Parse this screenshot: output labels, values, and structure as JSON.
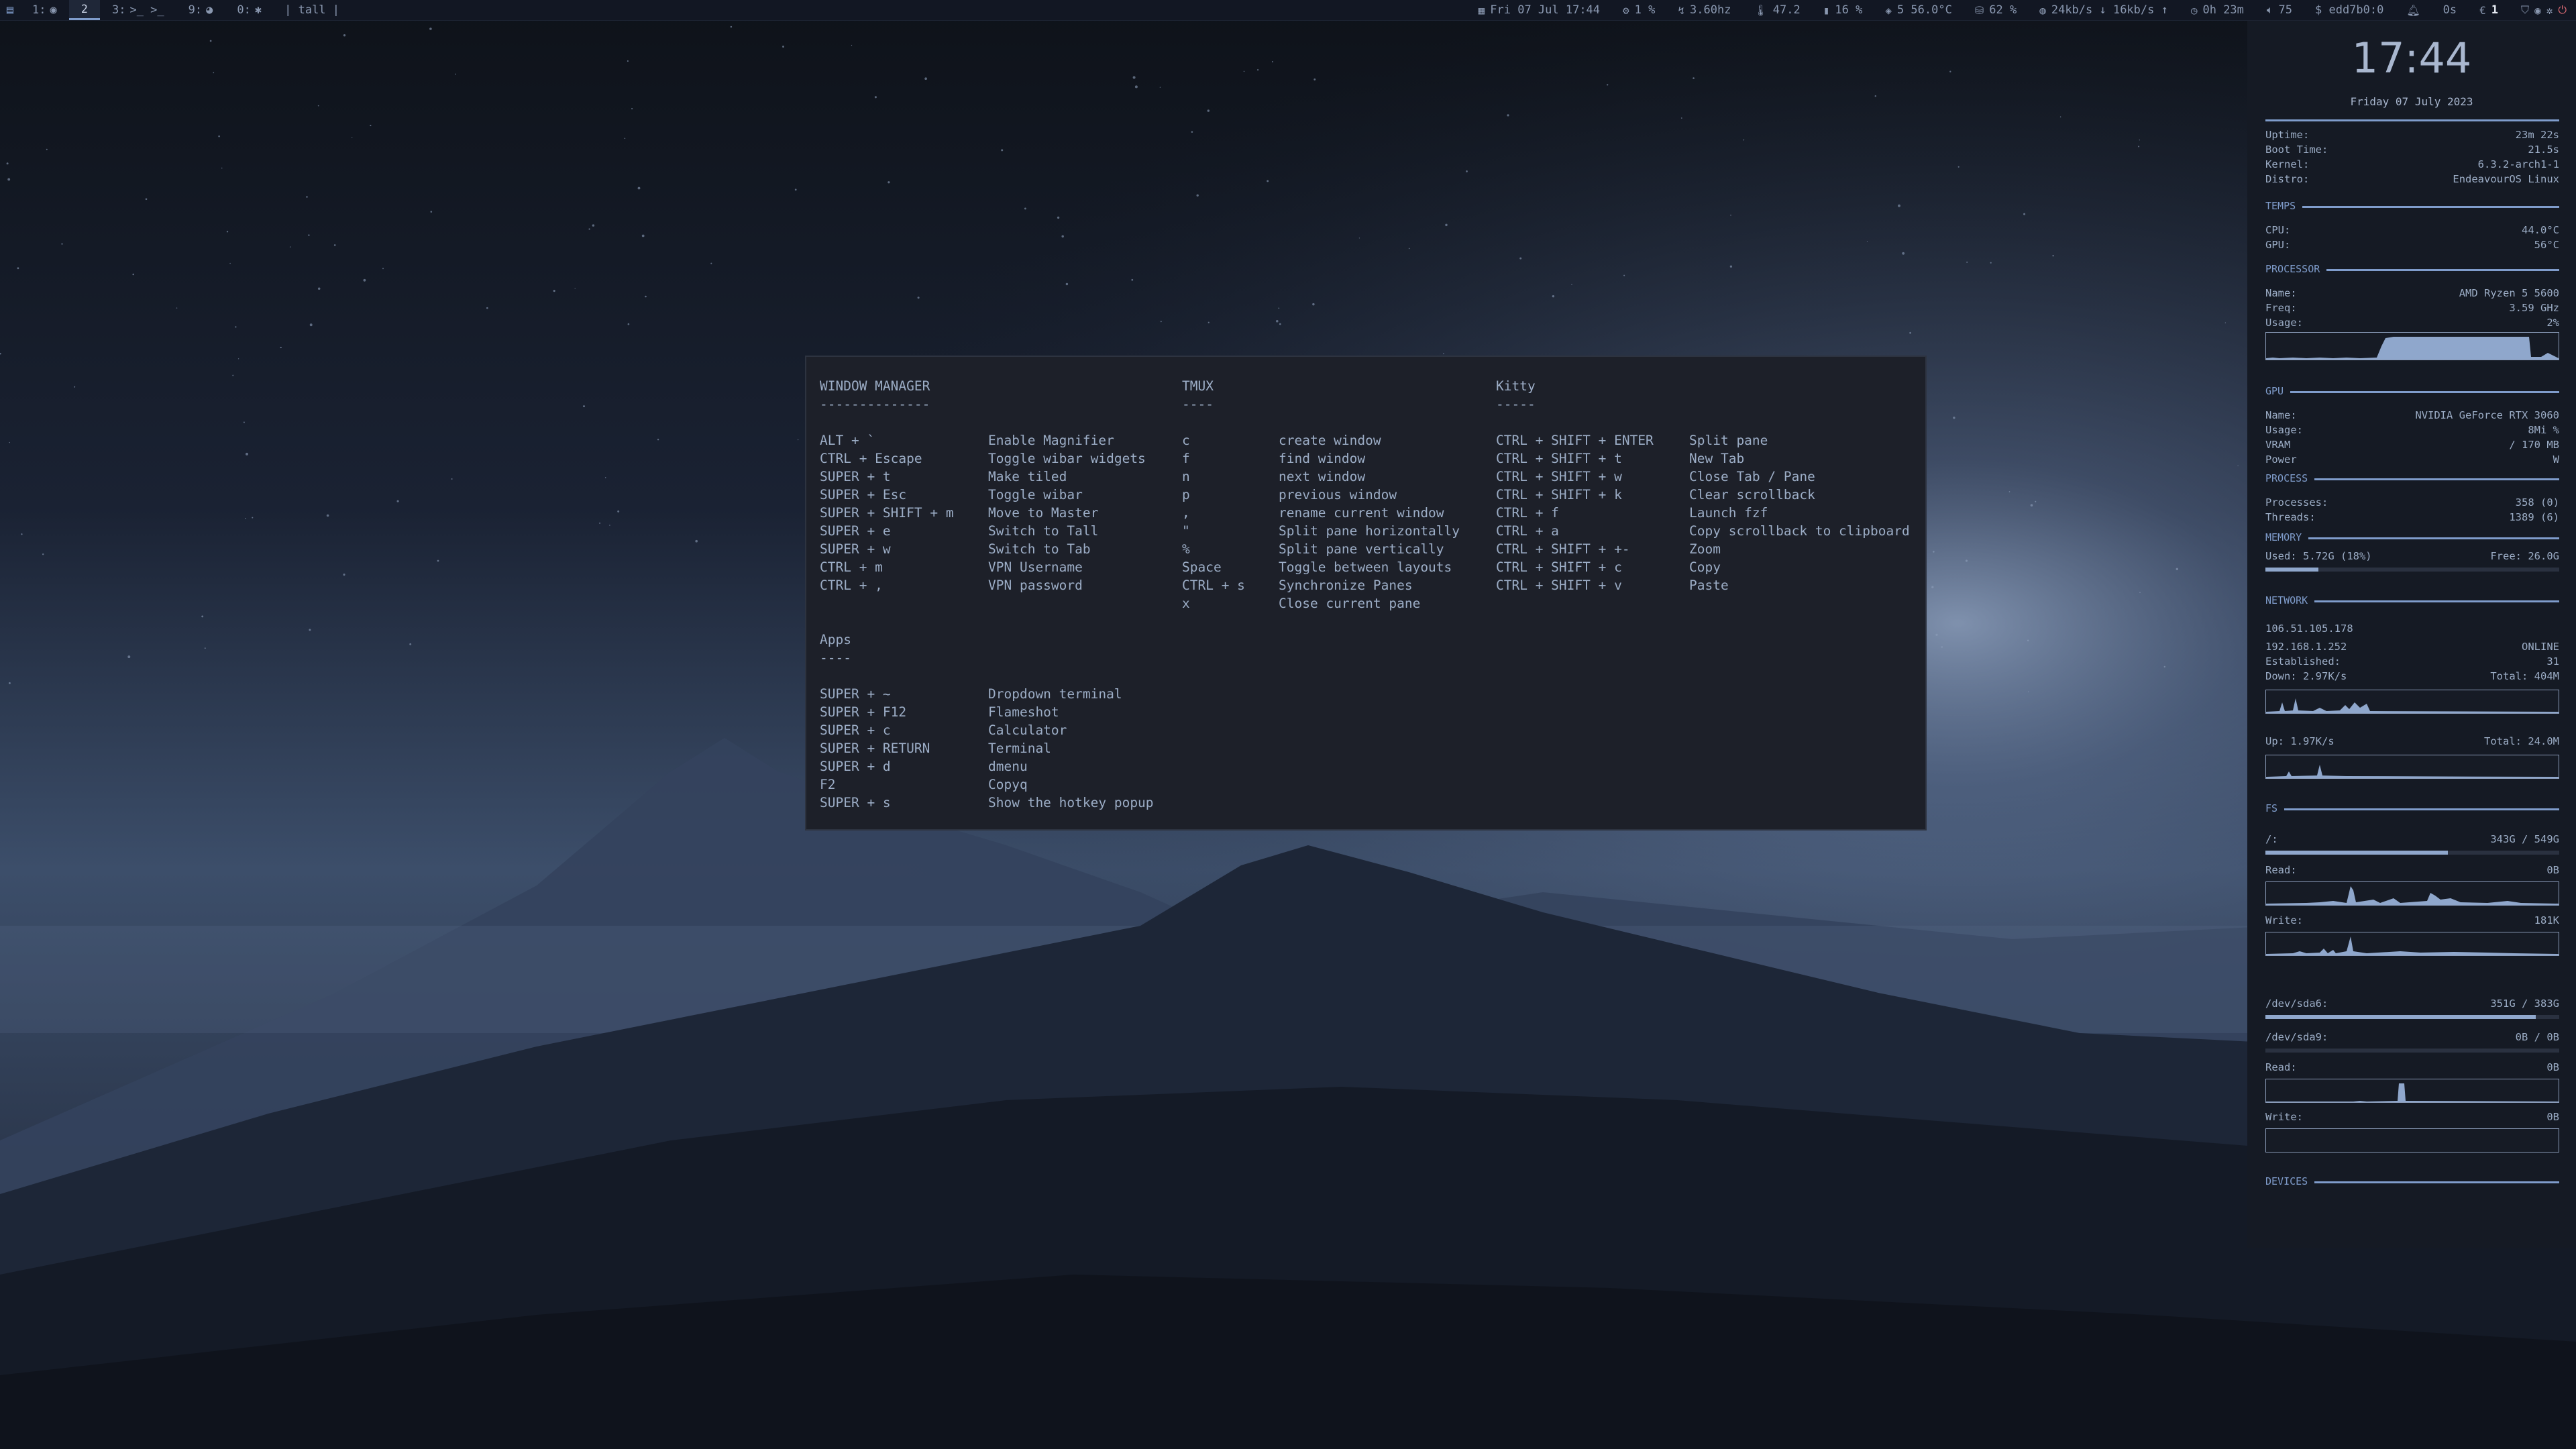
{
  "topbar": {
    "workspaces": [
      {
        "label": "1:",
        "icon": "firefox-icon",
        "glyph": "◉",
        "active": false
      },
      {
        "label": "2",
        "icon": "",
        "glyph": "",
        "active": true
      },
      {
        "label": "3:",
        "icon": "terminal-icon",
        "glyph": ">_ >_",
        "active": false
      },
      {
        "label": "9:",
        "icon": "spotify-icon",
        "glyph": "◕",
        "active": false
      },
      {
        "label": "0:",
        "icon": "gear-icon",
        "glyph": "✱",
        "active": false
      }
    ],
    "layout": "| tall |",
    "date": "Fri 07 Jul 17:44",
    "cpu": "1 %",
    "freq": "3.60hz",
    "temp": "47.2",
    "mem": "16 %",
    "gpu": "5 56.0°C",
    "disk": "62 %",
    "net": "24kb/s ↓ 16kb/s ↑",
    "uptime": "0h 23m",
    "volume": "75",
    "dollar": "$ edd7b0:0",
    "pomodoro": "0s",
    "updates": "1"
  },
  "popup": {
    "wm": {
      "title": "WINDOW MANAGER",
      "underline": "--------------",
      "rows": [
        {
          "k": "ALT + `",
          "v": "Enable Magnifier"
        },
        {
          "k": "CTRL + Escape",
          "v": "Toggle wibar widgets"
        },
        {
          "k": "SUPER + t",
          "v": "Make tiled"
        },
        {
          "k": "SUPER + Esc",
          "v": "Toggle wibar"
        },
        {
          "k": "SUPER + SHIFT + m",
          "v": "Move to Master"
        },
        {
          "k": "SUPER + e",
          "v": "Switch to Tall"
        },
        {
          "k": "SUPER + w",
          "v": "Switch to Tab"
        },
        {
          "k": "CTRL + m",
          "v": "VPN Username"
        },
        {
          "k": "CTRL + ,",
          "v": "VPN password"
        }
      ]
    },
    "apps": {
      "title": "Apps",
      "underline": "----",
      "rows": [
        {
          "k": "SUPER + ~",
          "v": "Dropdown terminal"
        },
        {
          "k": "SUPER + F12",
          "v": "Flameshot"
        },
        {
          "k": "SUPER + c",
          "v": "Calculator"
        },
        {
          "k": "SUPER + RETURN",
          "v": "Terminal"
        },
        {
          "k": "SUPER + d",
          "v": "dmenu"
        },
        {
          "k": "F2",
          "v": "Copyq"
        },
        {
          "k": "SUPER + s",
          "v": "Show the hotkey popup"
        }
      ]
    },
    "tmux": {
      "title": "TMUX",
      "underline": "----",
      "rows": [
        {
          "k": "c",
          "v": "create window"
        },
        {
          "k": "f",
          "v": "find window"
        },
        {
          "k": "n",
          "v": "next window"
        },
        {
          "k": "p",
          "v": "previous window"
        },
        {
          "k": ",",
          "v": "rename current window"
        },
        {
          "k": "\"",
          "v": "Split pane horizontally"
        },
        {
          "k": "%",
          "v": "Split pane vertically"
        },
        {
          "k": "Space",
          "v": "Toggle between layouts"
        },
        {
          "k": "CTRL + s",
          "v": "Synchronize Panes"
        },
        {
          "k": "x",
          "v": "Close current pane"
        }
      ]
    },
    "kitty": {
      "title": "Kitty",
      "underline": "-----",
      "rows": [
        {
          "k": "CTRL + SHIFT + ENTER",
          "v": "Split pane"
        },
        {
          "k": "CTRL + SHIFT + t",
          "v": "New Tab"
        },
        {
          "k": "CTRL + SHIFT + w",
          "v": "Close Tab / Pane"
        },
        {
          "k": "CTRL + SHIFT + k",
          "v": "Clear scrollback"
        },
        {
          "k": "CTRL + f",
          "v": "Launch fzf"
        },
        {
          "k": "CTRL + a",
          "v": "Copy scrollback to clipboard"
        },
        {
          "k": "CTRL + SHIFT + +-",
          "v": "Zoom"
        },
        {
          "k": "CTRL + SHIFT + c",
          "v": "Copy"
        },
        {
          "k": "CTRL + SHIFT + v",
          "v": "Paste"
        }
      ]
    }
  },
  "sidebar": {
    "clock": "17:44",
    "date": "Friday 07 July 2023",
    "system": [
      {
        "l": "Uptime:",
        "r": "23m 22s"
      },
      {
        "l": "Boot Time:",
        "r": "21.5s"
      },
      {
        "l": "Kernel:",
        "r": "6.3.2-arch1-1"
      },
      {
        "l": "Distro:",
        "r": "EndeavourOS Linux"
      }
    ],
    "temps_label": "TEMPS",
    "temps": [
      {
        "l": "CPU:",
        "r": "44.0°C"
      },
      {
        "l": "GPU:",
        "r": "56°C"
      }
    ],
    "processor_label": "PROCESSOR",
    "processor": [
      {
        "l": "Name:",
        "r": "AMD Ryzen 5 5600"
      },
      {
        "l": "Freq:",
        "r": "3.59 GHz"
      },
      {
        "l": "Usage:",
        "r": "2%"
      }
    ],
    "gpu_label": "GPU",
    "gpu": [
      {
        "l": "Name:",
        "r": "NVIDIA GeForce RTX 3060"
      },
      {
        "l": "Usage:",
        "r": "8Mi %"
      },
      {
        "l": "VRAM",
        "r": "/ 170 MB"
      },
      {
        "l": "Power",
        "r": "W"
      }
    ],
    "process_label": "PROCESS",
    "process": [
      {
        "l": "Processes:",
        "r": "358 (0)"
      },
      {
        "l": "Threads:",
        "r": "1389 (6)"
      }
    ],
    "memory_label": "MEMORY",
    "memory": {
      "l": "Used: 5.72G (18%)",
      "r": "Free: 26.0G",
      "fraction": 0.18
    },
    "network_label": "NETWORK",
    "network": {
      "public_ip": "106.51.105.178",
      "local_ip": "192.168.1.252",
      "status": "ONLINE",
      "established_l": "Established:",
      "established_r": "31",
      "down_l": "Down: 2.97K/s",
      "down_r": "Total: 404M",
      "up_l": "Up: 1.97K/s",
      "up_r": "Total: 24.0M"
    },
    "fs_label": "FS",
    "fs": {
      "root_l": "/:",
      "root_r": "343G / 549G",
      "root_fraction": 0.62,
      "read_l": "Read:",
      "read_r": "0B",
      "write_l": "Write:",
      "write_r": "181K",
      "sda6_l": "/dev/sda6:",
      "sda6_r": "351G / 383G",
      "sda6_fraction": 0.92,
      "sda9_l": "/dev/sda9:",
      "sda9_r": "0B / 0B",
      "sda9_fraction": 0,
      "read2_l": "Read:",
      "read2_r": "0B",
      "write2_l": "Write:",
      "write2_r": "0B"
    },
    "devices_label": "DEVICES"
  }
}
